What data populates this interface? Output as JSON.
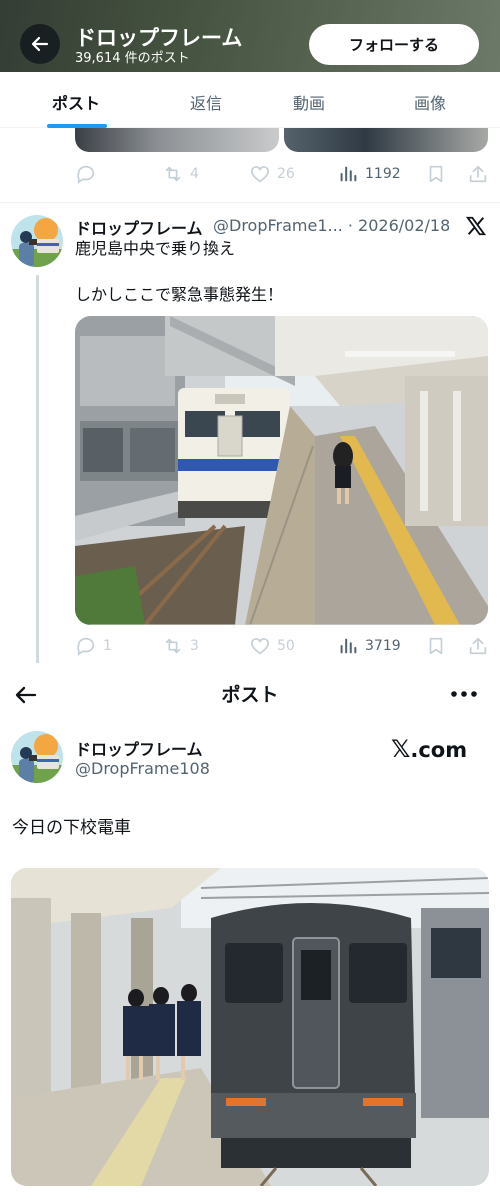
{
  "header": {
    "title": "ドロップフレーム",
    "subtitle": "39,614 件のポスト",
    "follow_label": "フォローする"
  },
  "tabs": [
    {
      "label": "ポスト",
      "active": true
    },
    {
      "label": "返信",
      "active": false
    },
    {
      "label": "動画",
      "active": false
    },
    {
      "label": "画像",
      "active": false
    }
  ],
  "prev_tweet": {
    "actions": {
      "retweets": "4",
      "likes": "26",
      "views": "1192"
    }
  },
  "tweet": {
    "author": "ドロップフレーム",
    "handle": "@DropFrame1... · 2026/02/18",
    "line1": "鹿児島中央で乗り換え",
    "line2": "しかしここで緊急事態発生！",
    "actions": {
      "replies": "1",
      "retweets": "3",
      "likes": "50",
      "views": "3719"
    }
  },
  "post_detail": {
    "title": "ポスト",
    "author": "ドロップフレーム",
    "handle": "@DropFrame108",
    "brand": {
      "x": "𝕏",
      "suffix": ".com"
    },
    "text": "今日の下校電車"
  },
  "colors": {
    "accent": "#1d9bf0",
    "text": "#0f1419",
    "muted": "#536471"
  }
}
